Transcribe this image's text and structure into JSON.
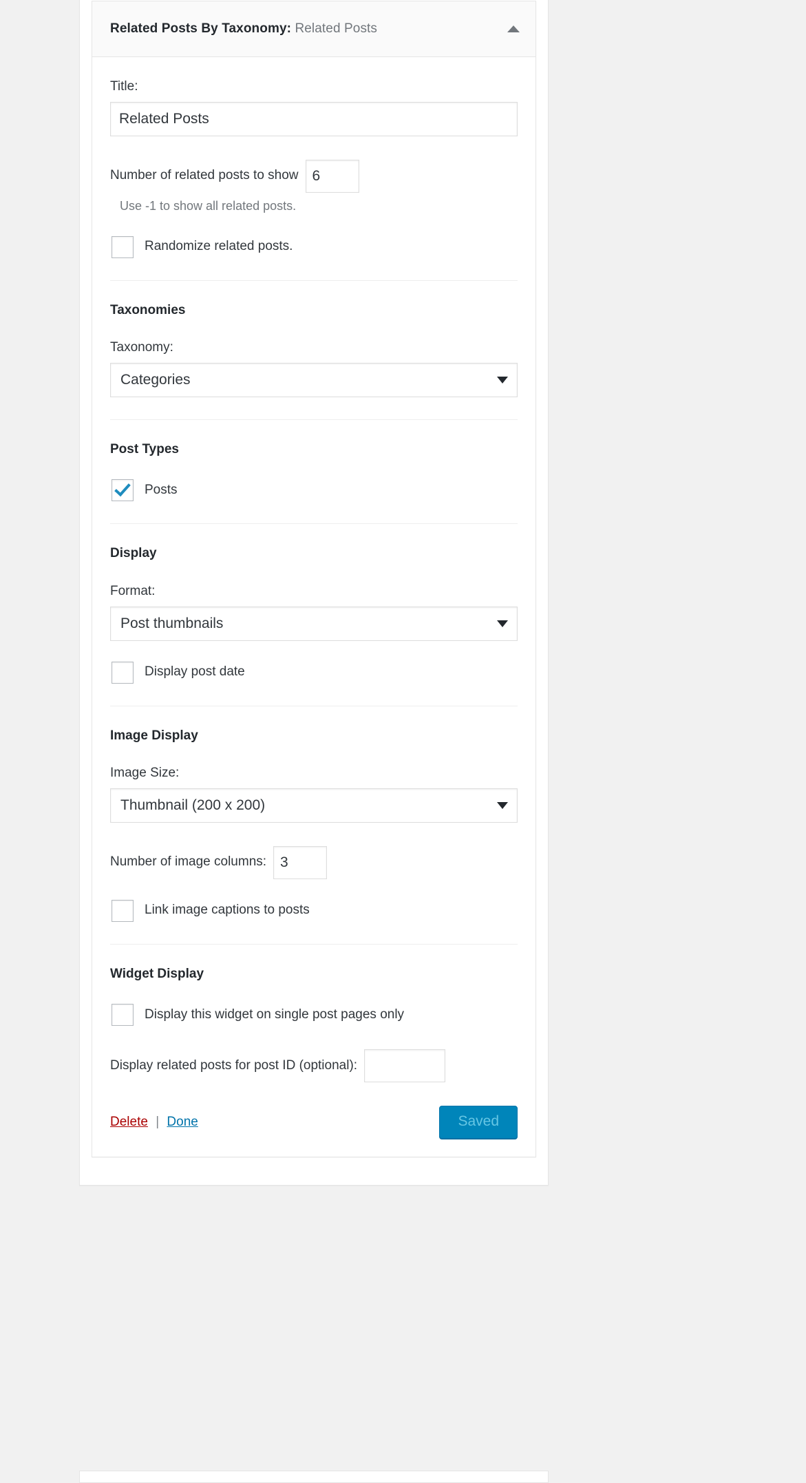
{
  "widget": {
    "header": {
      "type_label": "Related Posts By Taxonomy:",
      "instance_name": "Related Posts",
      "collapse_icon": "caret-up-icon"
    },
    "title_field": {
      "label": "Title:",
      "value": "Related Posts",
      "placeholder": ""
    },
    "posts_count": {
      "label": "Number of related posts to show",
      "value": "6",
      "help": "Use -1 to show all related posts."
    },
    "randomize": {
      "label": "Randomize related posts.",
      "checked": false
    },
    "taxonomies": {
      "heading": "Taxonomies",
      "taxonomy_label": "Taxonomy:",
      "taxonomy_value": "Categories"
    },
    "post_types": {
      "heading": "Post Types",
      "posts_label": "Posts",
      "posts_checked": true
    },
    "display": {
      "heading": "Display",
      "format_label": "Format:",
      "format_value": "Post thumbnails",
      "post_date_label": "Display post date",
      "post_date_checked": false
    },
    "image_display": {
      "heading": "Image Display",
      "image_size_label": "Image Size:",
      "image_size_value": "Thumbnail (200 x 200)",
      "columns_label": "Number of image columns:",
      "columns_value": "3",
      "link_captions_label": "Link image captions to posts",
      "link_captions_checked": false
    },
    "widget_display": {
      "heading": "Widget Display",
      "single_post_label": "Display this widget on single post pages only",
      "single_post_checked": false,
      "post_id_label": "Display related posts for post ID (optional):",
      "post_id_value": "",
      "post_id_placeholder": ""
    },
    "footer": {
      "delete_label": "Delete",
      "separator": "|",
      "done_label": "Done",
      "save_label": "Saved"
    }
  },
  "colors": {
    "accent": "#0085ba",
    "link": "#0073aa",
    "danger": "#a00",
    "checkmark": "#1e8cbe",
    "saved_text": "#66c6e4"
  }
}
